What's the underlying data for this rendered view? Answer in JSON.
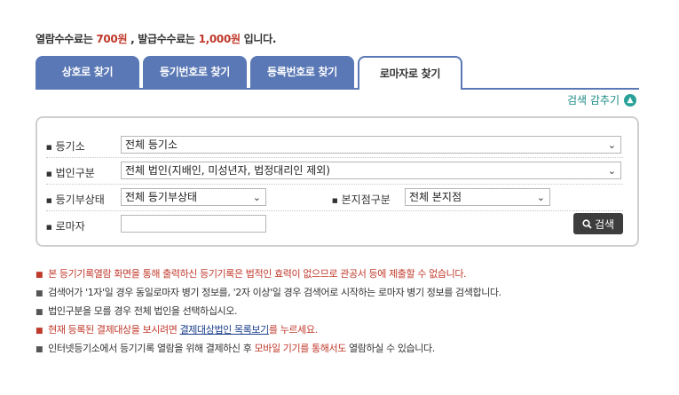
{
  "fee": {
    "part1": "열람수수료는 ",
    "view_fee": "700원",
    "part2": " , 발급수수료는 ",
    "issue_fee": "1,000원",
    "part3": " 입니다."
  },
  "tabs": [
    {
      "label": "상호로 찾기"
    },
    {
      "label": "등기번호로 찾기"
    },
    {
      "label": "등록번호로 찾기"
    },
    {
      "label": "로마자로 찾기",
      "active": true
    }
  ],
  "collapse_label": "검색 감추기",
  "form": {
    "registry_office": {
      "label": "등기소",
      "value": "전체 등기소"
    },
    "corp_type": {
      "label": "법인구분",
      "value": "전체 법인(지배인, 미성년자, 법정대리인 제외)"
    },
    "reg_status": {
      "label": "등기부상태",
      "value": "전체 등기부상태"
    },
    "branch_type": {
      "label": "본지점구분",
      "value": "전체 본지점"
    },
    "romaji": {
      "label": "로마자",
      "value": "",
      "placeholder": ""
    },
    "search_label": "검색"
  },
  "notes": {
    "n1": "본 등기기록열람 화면을 통해 출력하신 등기기록은 법적인 효력이 없으므로 관공서 등에 제출할 수 없습니다.",
    "n2": "검색어가 '1자'일 경우 동일로마자 병기 정보를, '2자 이상'일 경우 검색어로 시작하는 로마자 병기 정보를 검색합니다.",
    "n3": "법인구분을 모를 경우 전체 법인을 선택하십시오.",
    "n4_a": "현재 등록된 결제대상을 보시려면 ",
    "n4_link": "결제대상법인 목록보기",
    "n4_b": "를 누르세요.",
    "n5_a": "인터넷등기소에서 등기기록 열람을 위해 결제하신 후 ",
    "n5_red": "모바일 기기를 통해서도",
    "n5_b": " 열람하실 수 있습니다."
  },
  "colors": {
    "tab_blue": "#5a78b5",
    "accent_red": "#c0392b",
    "teal": "#2aa198",
    "button_dark": "#3d3d3d"
  }
}
